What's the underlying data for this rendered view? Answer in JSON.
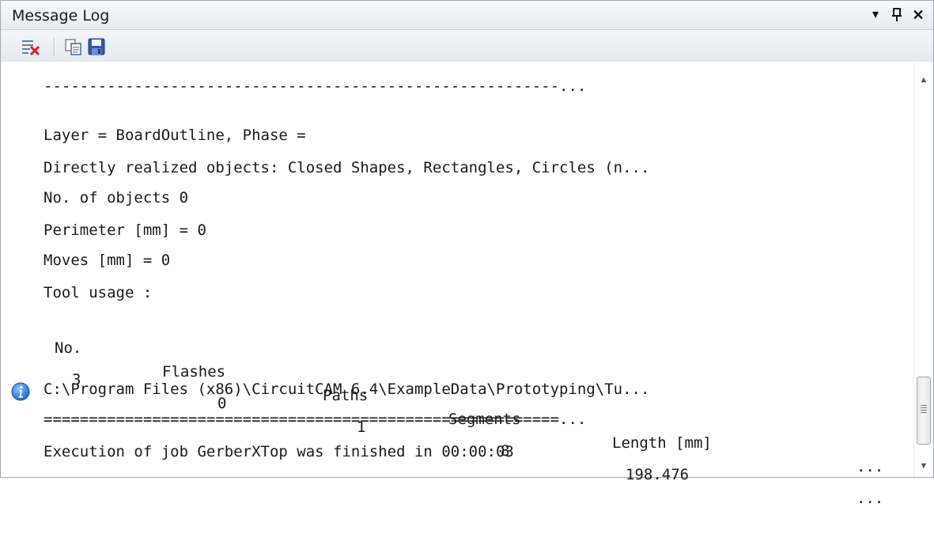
{
  "window": {
    "title": "Message Log",
    "controls": {
      "dropdown": "▾",
      "pin": "⊥",
      "close": "✕"
    }
  },
  "toolbar": {
    "tools": [
      {
        "icon": "clear-log-icon"
      },
      {
        "icon": "copy-icon"
      },
      {
        "icon": "save-icon"
      }
    ]
  },
  "log": {
    "lines": [
      "---------------------------------------------------------...",
      "Layer = BoardOutline, Phase =",
      "Directly realized objects: Closed Shapes, Rectangles, Circles (n...",
      "No. of objects 0",
      "Perimeter [mm] = 0",
      "Moves [mm] = 0",
      "Tool usage :"
    ],
    "tool_table": {
      "headers": [
        "No.",
        "Flashes",
        "Paths",
        "Segments",
        "Length [mm]",
        "..."
      ],
      "rows": [
        [
          "3",
          "0",
          "1",
          "8",
          "198.476",
          "..."
        ]
      ]
    },
    "path_line": "C:\\Program Files (x86)\\CircuitCAM 6.4\\ExampleData\\Prototyping\\Tu...",
    "separator_line": "=========================================================...",
    "info_message": "Execution of job GerberXTop was finished in 00:00:03"
  },
  "colors": {
    "info_icon": "#2f7fd9",
    "title_bar": "#e7ebf1"
  }
}
